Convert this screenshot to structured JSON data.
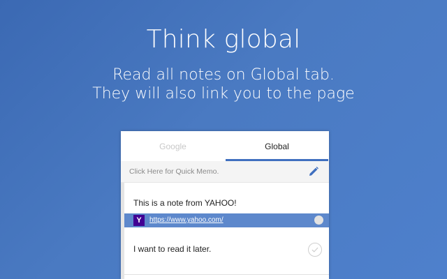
{
  "hero": {
    "title": "Think global",
    "subtitle_line1": "Read all notes on Global tab.",
    "subtitle_line2": "They will also link you to the page"
  },
  "panel": {
    "tabs": [
      {
        "label": "Google",
        "active": false
      },
      {
        "label": "Global",
        "active": true
      }
    ],
    "memo": {
      "placeholder": "Click Here for Quick Memo.",
      "icon": "pencil-icon"
    },
    "notes": [
      {
        "text": "This is a note from YAHOO!",
        "link": {
          "site_icon": "yahoo-icon",
          "site_icon_letter": "Y",
          "url": "https://www.yahoo.com/"
        }
      },
      {
        "text": "I want to read it later.",
        "status_icon": "check-circle-icon"
      }
    ]
  },
  "colors": {
    "background": "#4a7ac2",
    "accent": "#3f6fbf",
    "link_row": "#5d88cc",
    "yahoo_brand": "#410093"
  }
}
